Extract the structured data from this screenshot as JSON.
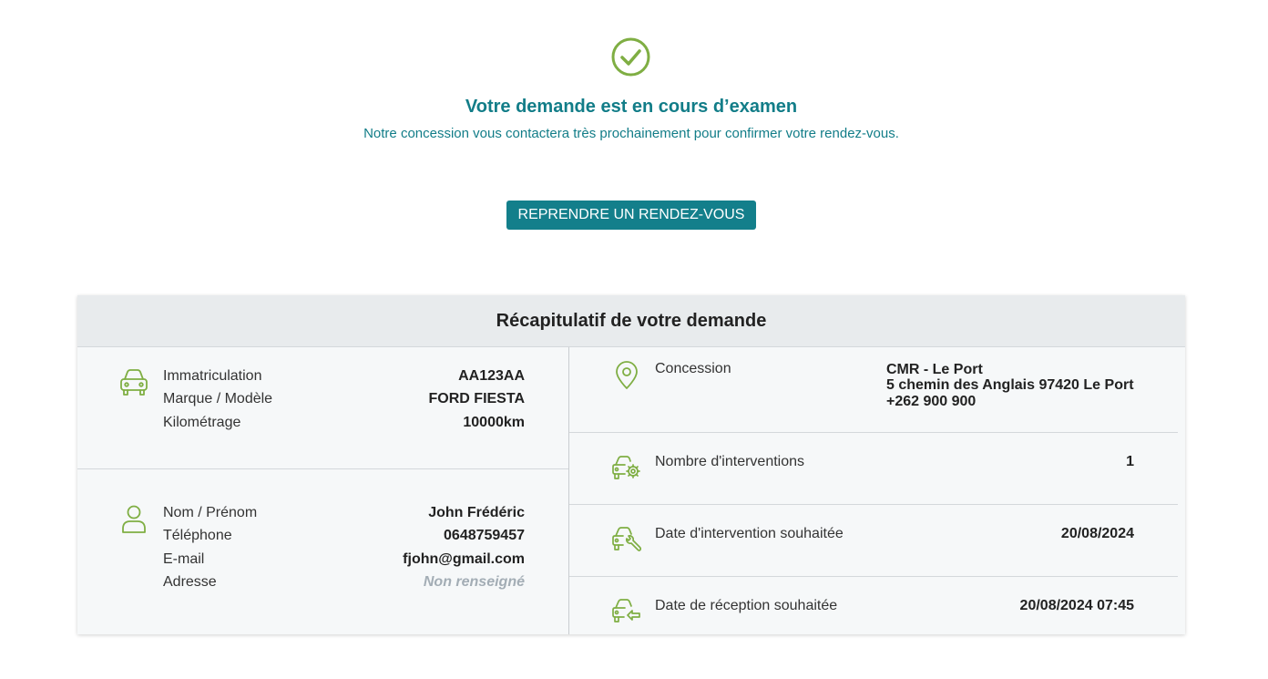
{
  "confirmation": {
    "title": "Votre demande est en cours d’examen",
    "subtitle": "Notre concession vous contactera très prochainement pour confirmer votre rendez-vous.",
    "button_label": "REPRENDRE UN RENDEZ-VOUS"
  },
  "summary": {
    "title": "Récapitulatif de votre demande",
    "vehicle": {
      "rows": [
        {
          "label": "Immatriculation",
          "value": "AA123AA"
        },
        {
          "label": "Marque / Modèle",
          "value": "FORD FIESTA"
        },
        {
          "label": "Kilométrage",
          "value": "10000km"
        }
      ]
    },
    "customer": {
      "rows": [
        {
          "label": "Nom / Prénom",
          "value": "John Frédéric"
        },
        {
          "label": "Téléphone",
          "value": "0648759457"
        },
        {
          "label": "E-mail",
          "value": "fjohn@gmail.com"
        },
        {
          "label": "Adresse",
          "value": "Non renseigné"
        }
      ]
    },
    "dealership": {
      "label": "Concession",
      "name": "CMR - Le Port",
      "address": "5 chemin des Anglais 97420 Le Port",
      "phone": "+262 900 900"
    },
    "interventions": {
      "label": "Nombre d'interventions",
      "value": "1"
    },
    "intervention_date": {
      "label": "Date d'intervention souhaitée",
      "value": "20/08/2024"
    },
    "reception_date": {
      "label": "Date de réception souhaitée",
      "value": "20/08/2024 07:45"
    }
  },
  "colors": {
    "accent_teal": "#137f8b",
    "icon_green": "#7fae43",
    "muted_text": "#a3adb5"
  },
  "icons": [
    "check-circle-icon",
    "car-icon",
    "user-icon",
    "map-pin-icon",
    "car-gear-icon",
    "car-wrench-icon",
    "car-key-icon"
  ]
}
